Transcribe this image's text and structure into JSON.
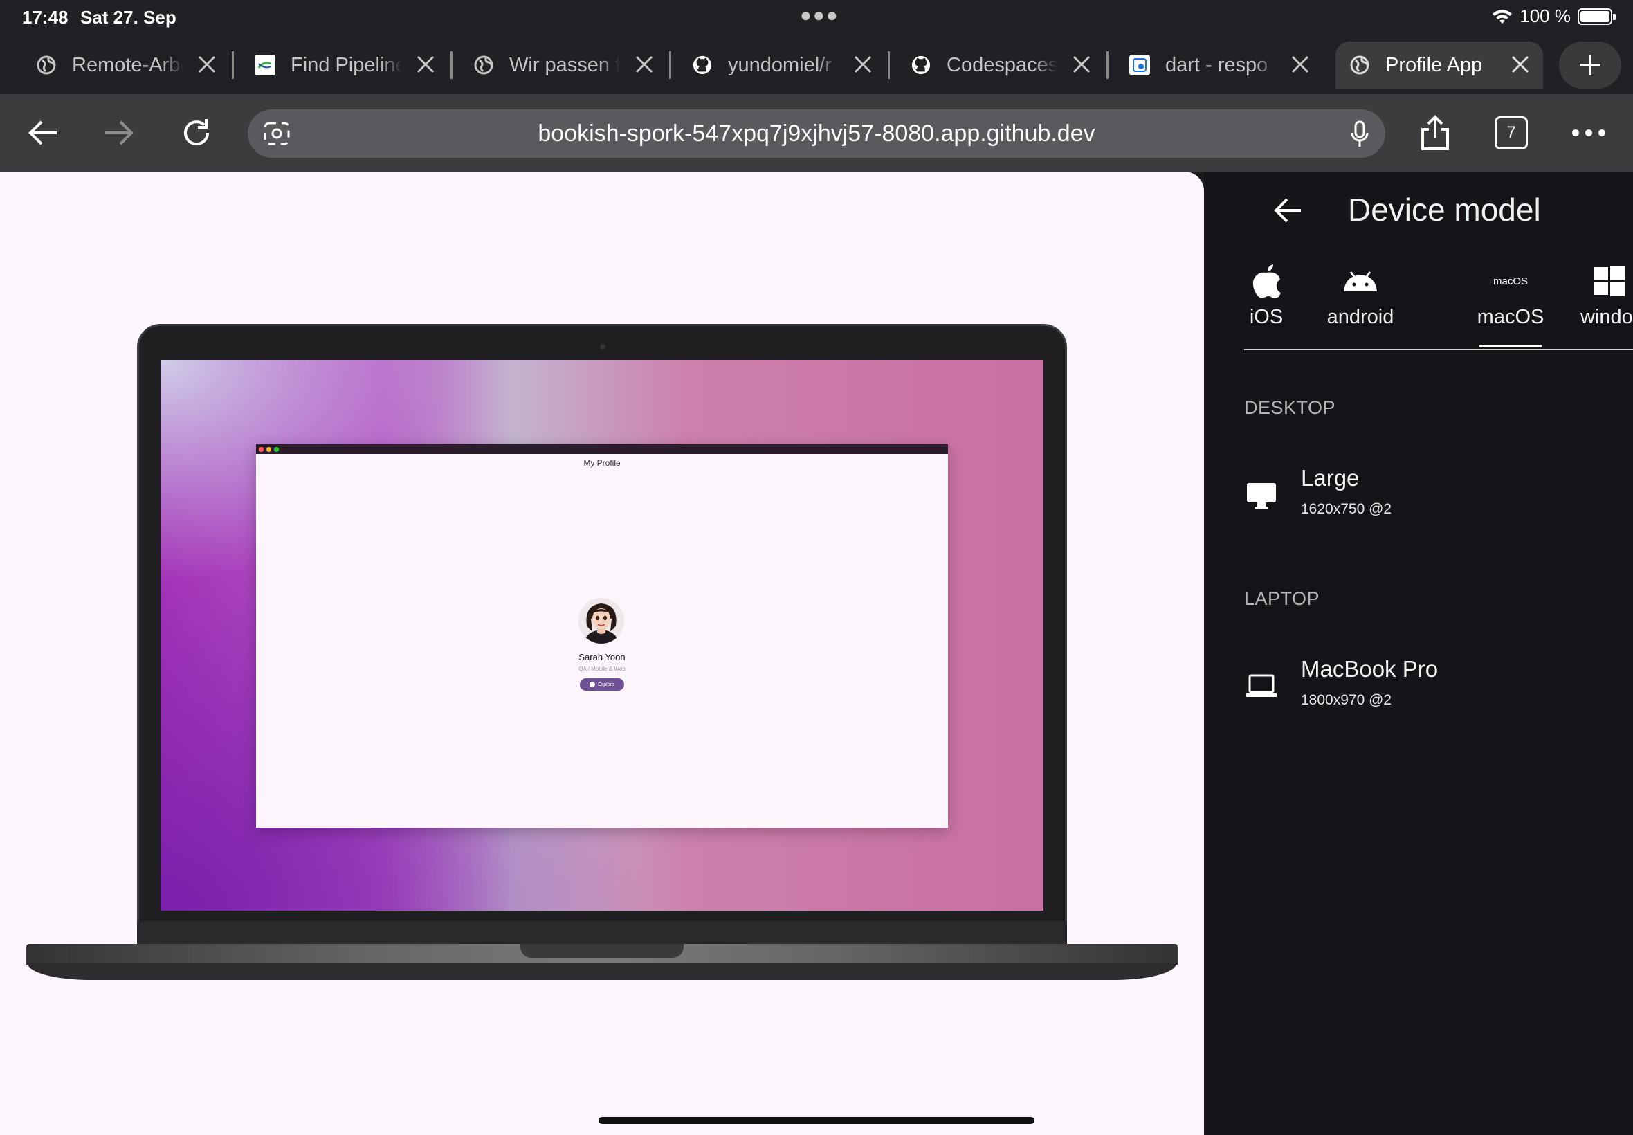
{
  "status": {
    "time": "17:48",
    "date": "Sat 27. Sep",
    "battery": "100 %"
  },
  "tabs": [
    {
      "title": "Remote-Arbeit",
      "icon": "globe-icon"
    },
    {
      "title": "Find Pipeline",
      "icon": "pipeline-favicon"
    },
    {
      "title": "Wir passen f",
      "icon": "globe-icon"
    },
    {
      "title": "yundomiel/r",
      "icon": "github-icon"
    },
    {
      "title": "Codespaces",
      "icon": "github-icon"
    },
    {
      "title": "dart - respo",
      "icon": "stackoverflow-favicon"
    },
    {
      "title": "Profile App",
      "icon": "globe-icon",
      "active": true
    }
  ],
  "toolbar": {
    "url": "bookish-spork-547xpq7j9xjhvj57-8080.app.github.dev",
    "tab_count": "7"
  },
  "preview": {
    "app_title": "My Profile",
    "name": "Sarah Yoon",
    "role": "QA / Mobile & Web",
    "button": "Explore"
  },
  "panel": {
    "title": "Device model",
    "os_tabs": [
      {
        "label": "iOS",
        "icon": "apple-icon"
      },
      {
        "label": "android",
        "icon": "android-icon"
      },
      {
        "label": "macOS",
        "icon": "macos-icon",
        "icon_text": "macOS",
        "selected": true
      },
      {
        "label": "windo",
        "icon": "windows-icon"
      }
    ],
    "sections": [
      {
        "title": "DESKTOP",
        "items": [
          {
            "name": "Large",
            "spec": "1620x750 @2",
            "icon": "desktop-icon"
          }
        ]
      },
      {
        "title": "LAPTOP",
        "items": [
          {
            "name": "MacBook Pro",
            "spec": "1800x970 @2",
            "icon": "laptop-icon"
          }
        ]
      }
    ]
  },
  "colors": {
    "page_bg": "#fdf5fc",
    "panel_bg": "#161418",
    "accent": "#6e5094"
  }
}
